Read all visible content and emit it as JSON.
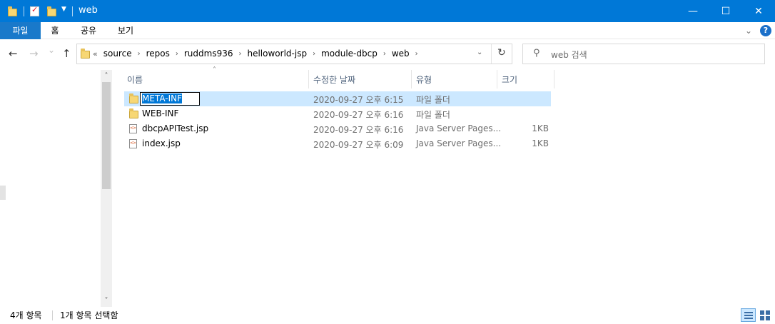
{
  "window": {
    "title": "web",
    "minimize_glyph": "—",
    "maximize_glyph": "☐",
    "close_glyph": "✕"
  },
  "ribbon": {
    "tabs": [
      {
        "label": "파일",
        "active": true
      },
      {
        "label": "홈",
        "active": false
      },
      {
        "label": "공유",
        "active": false
      },
      {
        "label": "보기",
        "active": false
      }
    ],
    "help_label": "?"
  },
  "nav": {
    "back_glyph": "←",
    "forward_glyph": "→",
    "recent_glyph": "⌄",
    "up_glyph": "↑",
    "overflow_glyph": "«",
    "breadcrumbs": [
      "source",
      "repos",
      "ruddms936",
      "helloworld-jsp",
      "module-dbcp",
      "web"
    ],
    "crumb_sep": "›",
    "refresh_glyph": "↻"
  },
  "search": {
    "placeholder": "web 검색",
    "icon": "search-icon"
  },
  "columns": {
    "name": "이름",
    "date": "수정한 날짜",
    "type": "유형",
    "size": "크기"
  },
  "files": [
    {
      "name": "META-INF",
      "date": "2020-09-27 오후 6:15",
      "type": "파일 폴더",
      "size": "",
      "kind": "folder",
      "selected": true,
      "editing": true
    },
    {
      "name": "WEB-INF",
      "date": "2020-09-27 오후 6:16",
      "type": "파일 폴더",
      "size": "",
      "kind": "folder",
      "selected": false,
      "editing": false
    },
    {
      "name": "dbcpAPITest.jsp",
      "date": "2020-09-27 오후 6:16",
      "type": "Java Server Pages...",
      "size": "1KB",
      "kind": "file",
      "selected": false,
      "editing": false
    },
    {
      "name": "index.jsp",
      "date": "2020-09-27 오후 6:09",
      "type": "Java Server Pages...",
      "size": "1KB",
      "kind": "file",
      "selected": false,
      "editing": false
    }
  ],
  "status": {
    "item_count": "4개 항목",
    "selection": "1개 항목 선택함"
  },
  "colors": {
    "titlebar": "#0078d7",
    "selection": "#cce8ff",
    "active_tab": "#1979ca"
  }
}
